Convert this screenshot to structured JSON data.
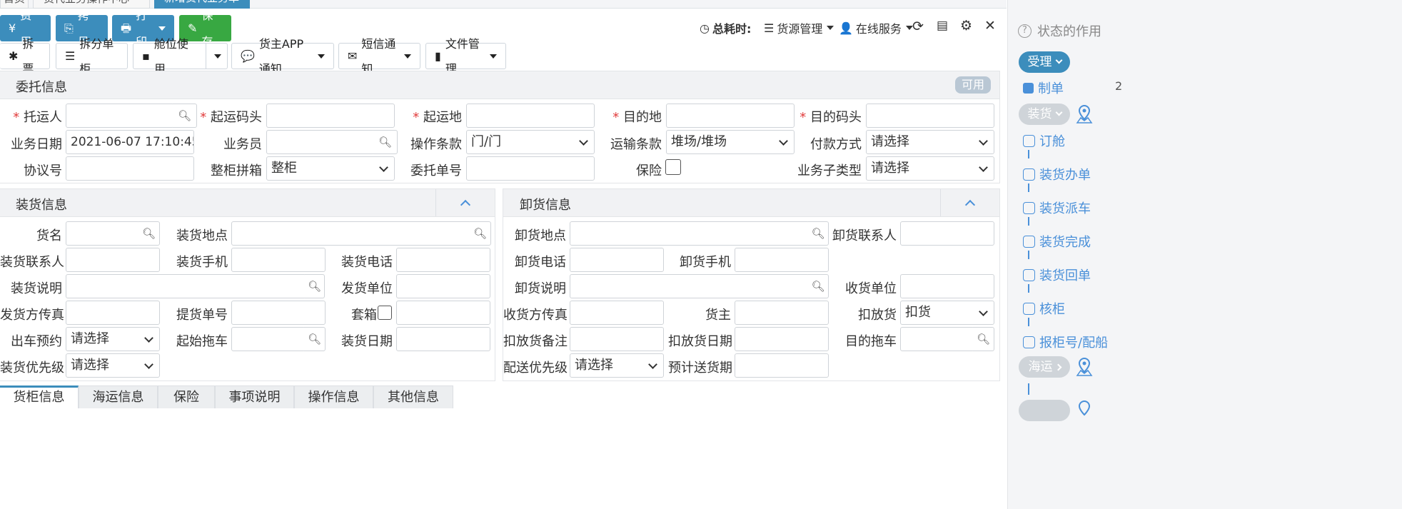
{
  "top_tabs": [
    "首页",
    "货代业务操作中心",
    "新增货代业务单"
  ],
  "toolbar1": {
    "fee": "费用",
    "copy": "拷贝",
    "print": "打印",
    "save": "保存"
  },
  "toolbar2": {
    "split": "拆票",
    "split_container": "拆分单柜",
    "space": "舱位使用",
    "app_notify": "货主APP通知",
    "sms": "短信通知",
    "file_mgmt": "文件管理"
  },
  "header_right": {
    "total_time": "总耗时:",
    "cargo_mgmt": "货源管理",
    "online": "在线服务"
  },
  "consign": {
    "title": "委托信息",
    "badge": "可用",
    "shipper": "托运人",
    "origin_port": "起运码头",
    "origin": "起运地",
    "dest": "目的地",
    "dest_port": "目的码头",
    "biz_date_label": "业务日期",
    "biz_date": "2021-06-07 17:10:45",
    "salesman": "业务员",
    "op_terms_label": "操作条款",
    "op_terms": "门/门",
    "trans_terms_label": "运输条款",
    "trans_terms": "堆场/堆场",
    "pay_label": "付款方式",
    "pay": "请选择",
    "agreement": "协议号",
    "fcl_label": "整柜拼箱",
    "fcl": "整柜",
    "order_no": "委托单号",
    "insurance": "保险",
    "subtype_label": "业务子类型",
    "subtype": "请选择"
  },
  "loading": {
    "title": "装货信息",
    "goods": "货名",
    "place": "装货地点",
    "contact": "装货联系人",
    "mobile": "装货手机",
    "phone": "装货电话",
    "note": "装货说明",
    "sender": "发货单位",
    "sender_fax": "发货方传真",
    "pickup_no": "提货单号",
    "box": "套箱",
    "truck_label": "出车预约",
    "truck": "请选择",
    "start_trailer": "起始拖车",
    "date": "装货日期",
    "priority_label": "装货优先级",
    "priority": "请选择"
  },
  "unloading": {
    "title": "卸货信息",
    "place": "卸货地点",
    "contact": "卸货联系人",
    "phone": "卸货电话",
    "mobile": "卸货手机",
    "note": "卸货说明",
    "receiver": "收货单位",
    "receiver_fax": "收货方传真",
    "owner": "货主",
    "hold_label": "扣放货",
    "hold": "扣货",
    "hold_note": "扣放货备注",
    "hold_date": "扣放货日期",
    "dest_trailer": "目的拖车",
    "delivery_priority_label": "配送优先级",
    "delivery_priority": "请选择",
    "expected_date": "预计送货期"
  },
  "bottom_tabs": [
    "货柜信息",
    "海运信息",
    "保险",
    "事项说明",
    "操作信息",
    "其他信息"
  ],
  "sidebar": {
    "title": "状态的作用",
    "accept": "受理",
    "make": "制单",
    "load": "装货",
    "steps": [
      "订舱",
      "装货办单",
      "装货派车",
      "装货完成",
      "装货回单",
      "核柜",
      "报柜号/配船"
    ],
    "sea": "海运",
    "edge_num": "2"
  }
}
